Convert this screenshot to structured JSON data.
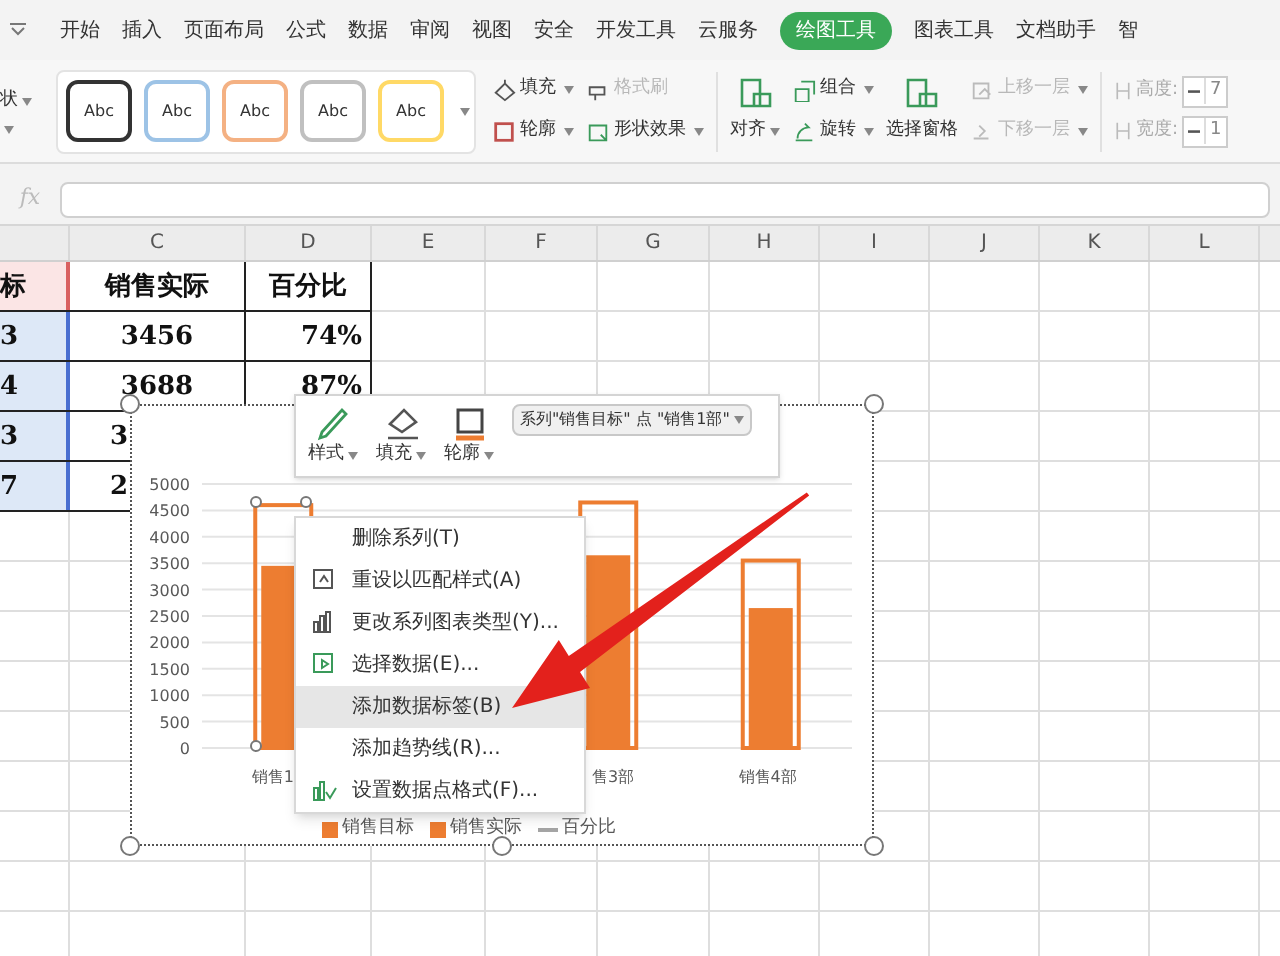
{
  "ribbon_tabs": [
    {
      "label": "开始",
      "selected": false
    },
    {
      "label": "插入",
      "selected": false
    },
    {
      "label": "页面布局",
      "selected": false
    },
    {
      "label": "公式",
      "selected": false
    },
    {
      "label": "数据",
      "selected": false
    },
    {
      "label": "审阅",
      "selected": false
    },
    {
      "label": "视图",
      "selected": false
    },
    {
      "label": "安全",
      "selected": false
    },
    {
      "label": "开发工具",
      "selected": false
    },
    {
      "label": "云服务",
      "selected": false
    },
    {
      "label": "绘图工具",
      "selected": true
    },
    {
      "label": "图表工具",
      "selected": false
    },
    {
      "label": "文档助手",
      "selected": false
    },
    {
      "label": "智",
      "selected": false
    }
  ],
  "ribbon": {
    "cut_label": "状",
    "style_gallery": [
      {
        "label": "Abc",
        "color": "#333333"
      },
      {
        "label": "Abc",
        "color": "#9dc3e6"
      },
      {
        "label": "Abc",
        "color": "#f4b183"
      },
      {
        "label": "Abc",
        "color": "#c0c0c0"
      },
      {
        "label": "Abc",
        "color": "#ffd966"
      }
    ],
    "tools": [
      {
        "kind": "stack",
        "items": [
          {
            "label": "填充",
            "dropdown": true,
            "disabled": false
          },
          {
            "label": "轮廓",
            "dropdown": true,
            "disabled": false
          }
        ]
      },
      {
        "kind": "stack",
        "items": [
          {
            "label": "格式刷",
            "dropdown": false,
            "disabled": true
          },
          {
            "label": "形状效果",
            "dropdown": true,
            "disabled": false
          }
        ]
      },
      {
        "kind": "separator"
      },
      {
        "kind": "big",
        "label": "对齐",
        "dropdown": true,
        "disabled": false
      },
      {
        "kind": "stack",
        "items": [
          {
            "label": "组合",
            "dropdown": true,
            "disabled": false
          },
          {
            "label": "旋转",
            "dropdown": true,
            "disabled": false
          }
        ]
      },
      {
        "kind": "big",
        "label": "选择窗格",
        "dropdown": false,
        "disabled": false
      },
      {
        "kind": "stack",
        "items": [
          {
            "label": "上移一层",
            "dropdown": true,
            "disabled": true
          },
          {
            "label": "下移一层",
            "dropdown": true,
            "disabled": true
          }
        ]
      },
      {
        "kind": "separator"
      }
    ],
    "size_fields": [
      {
        "label": "高度:",
        "value": "7"
      },
      {
        "label": "宽度:",
        "value": "1"
      }
    ]
  },
  "formula_bar": {
    "fx": "fx"
  },
  "sheet": {
    "columns": [
      "",
      "C",
      "D",
      "E",
      "F",
      "G",
      "H",
      "I",
      "J",
      "K",
      "L"
    ],
    "rows": [
      {
        "cells": [
          "标",
          "销售实际",
          "百分比"
        ],
        "selected": false
      },
      {
        "cells": [
          "3",
          "3456",
          "74%"
        ],
        "selected": true
      },
      {
        "cells": [
          "4",
          "3688",
          "87%"
        ],
        "selected": true
      },
      {
        "cells": [
          "3",
          "3"
        ],
        "selected": true
      },
      {
        "cells": [
          "7",
          "2"
        ],
        "selected": true
      }
    ]
  },
  "chart": {
    "chart_data": {
      "type": "bar",
      "grid": true,
      "categories": [
        "销售1",
        null,
        "售3部",
        "销售4部"
      ],
      "ylim": [
        0,
        5000
      ],
      "yticks": [
        0,
        500,
        1000,
        1500,
        2000,
        2500,
        3000,
        3500,
        4000,
        4500,
        5000
      ],
      "series": [
        {
          "name": "销售目标",
          "color": "#ed7d31",
          "values": [
            4600,
            null,
            4650,
            3550
          ]
        },
        {
          "name": "销售实际",
          "color": "#ed7d31",
          "values": [
            3450,
            null,
            3650,
            2650
          ]
        }
      ]
    },
    "extra_legend": [
      {
        "label": "百分比",
        "color": "#a5a5a5"
      }
    ]
  },
  "float_toolbar": {
    "buttons": [
      {
        "label": "样式"
      },
      {
        "label": "填充"
      },
      {
        "label": "轮廓"
      }
    ],
    "element_select": "系列\"销售目标\" 点 \"销售1部\""
  },
  "context_menu": [
    {
      "label": "删除系列(T)",
      "selected": false
    },
    {
      "label": "重设以匹配样式(A)",
      "selected": false
    },
    {
      "label": "更改系列图表类型(Y)...",
      "selected": false
    },
    {
      "label": "选择数据(E)...",
      "selected": false
    },
    {
      "label": "添加数据标签(B)",
      "selected": true
    },
    {
      "label": "添加趋势线(R)...",
      "selected": false
    },
    {
      "label": "设置数据点格式(F)...",
      "selected": false
    }
  ]
}
